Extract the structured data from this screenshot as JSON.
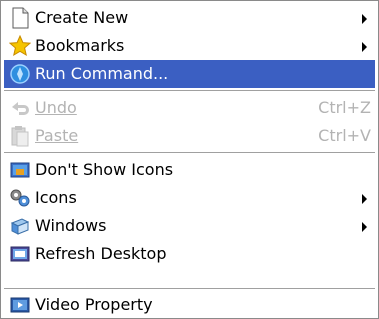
{
  "menu": {
    "items": [
      {
        "label": "Create New",
        "icon": "document-icon",
        "submenu": true
      },
      {
        "label": "Bookmarks",
        "icon": "star-icon",
        "submenu": true
      },
      {
        "label": "Run Command...",
        "icon": "run-command-icon",
        "highlighted": true
      },
      {
        "label": "Undo",
        "icon": "undo-icon",
        "shortcut": "Ctrl+Z",
        "disabled": true
      },
      {
        "label": "Paste",
        "icon": "paste-icon",
        "shortcut": "Ctrl+V",
        "disabled": true
      },
      {
        "label": "Don't Show Icons",
        "icon": "desktop-icon"
      },
      {
        "label": "Icons",
        "icon": "icons-icon",
        "submenu": true
      },
      {
        "label": "Windows",
        "icon": "windows-icon",
        "submenu": true
      },
      {
        "label": "Refresh Desktop",
        "icon": "refresh-desktop-icon"
      },
      {
        "label": "Video Property",
        "icon": "video-property-icon"
      }
    ]
  },
  "colors": {
    "highlight": "#3b5fc2",
    "disabled_text": "#b3b3b3"
  }
}
